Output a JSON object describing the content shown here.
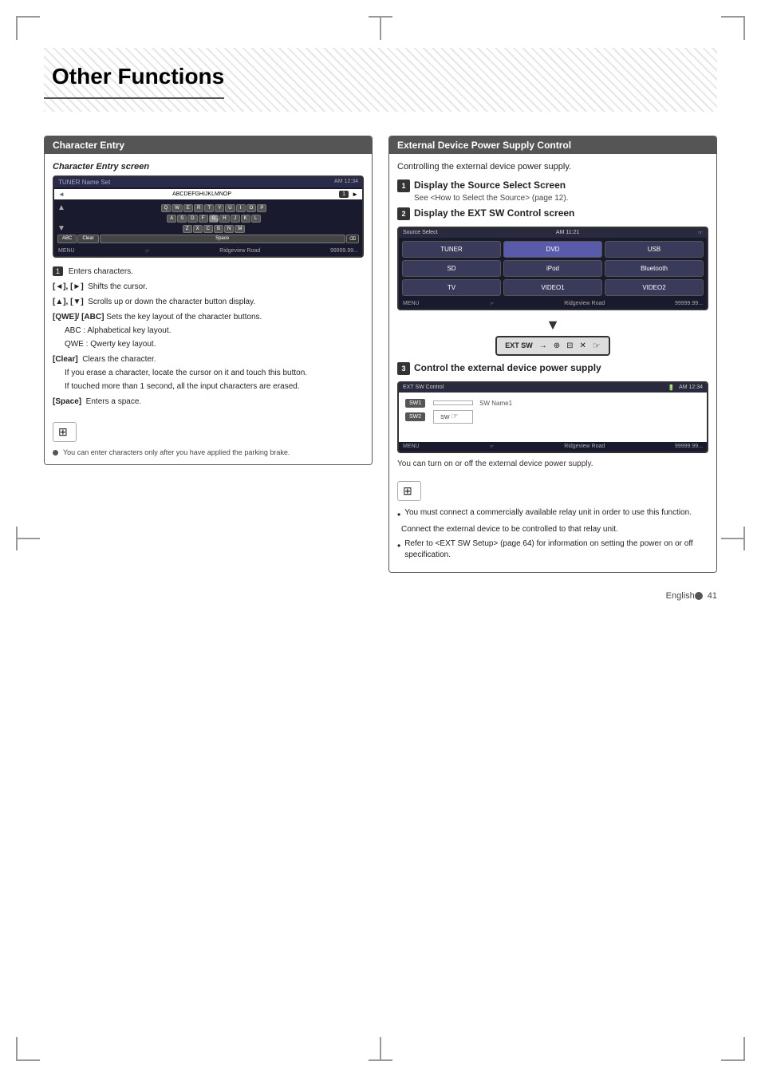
{
  "page": {
    "title": "Other Functions",
    "footer_text": "English",
    "page_number": "41"
  },
  "left_section": {
    "title": "Character Entry",
    "subtitle": "Character Entry screen",
    "screen": {
      "title_bar": "TUNER Name Set",
      "top_bar_icons": "AM 12:34",
      "input_row": "ABCDEFGHIJKLMNOP",
      "input_number": "1",
      "rows": [
        [
          "Q",
          "W",
          "E",
          "R",
          "T",
          "Y",
          "U",
          "I",
          "O",
          "P"
        ],
        [
          "A",
          "S",
          "D",
          "F",
          "G",
          "H",
          "J",
          "K",
          "L"
        ],
        [
          "Z",
          "X",
          "C",
          "B",
          "N",
          "M"
        ]
      ],
      "special_keys": [
        "ABC",
        "Clear",
        "Space"
      ],
      "bottom_left": "MENU",
      "bottom_road": "Ridgeview Road",
      "bottom_right": "99999.99..."
    },
    "items": [
      {
        "number": "1",
        "text": "Enters characters."
      },
      {
        "label": "[◄], [►]",
        "text": "Shifts the cursor."
      },
      {
        "label": "[▲], [▼]",
        "text": "Scrolls up or down the character button display."
      },
      {
        "label": "[QWE]/ [ABC]",
        "text": "Sets the key layout of the character buttons."
      },
      {
        "sublabel1": "ABC : Alphabetical key layout.",
        "sublabel2": "QWE : Qwerty key layout."
      },
      {
        "label": "[Clear]",
        "text": "Clears the character."
      },
      {
        "sub": "If you erase a character, locate the cursor on it and touch this button."
      },
      {
        "sub": "If touched more than 1 second, all the input characters are erased."
      },
      {
        "label": "[Space]",
        "text": "Enters a space."
      }
    ],
    "note_icon": "⊞",
    "note_text": "• You can enter characters only after you have applied the parking brake."
  },
  "right_section": {
    "title": "External Device Power Supply Control",
    "intro": "Controlling the external device power supply.",
    "steps": [
      {
        "number": "1",
        "title": "Display the Source Select Screen",
        "desc": "See <How to Select the Source> (page 12)."
      },
      {
        "number": "2",
        "title": "Display the EXT SW Control screen",
        "source_screen": {
          "top_bar": "Source Select",
          "top_bar_right": "AM 11:21",
          "buttons": [
            "TUNER",
            "DVD",
            "USB",
            "SD",
            "iPod",
            "Bluetooth",
            "TV",
            "VIDEO1",
            "VIDEO2"
          ],
          "bottom_left": "MENU",
          "bottom_road": "Ridgeview Road",
          "bottom_right": "99999.99..."
        },
        "ext_sw_bar": {
          "label": "EXT SW",
          "icons": [
            "→",
            "⊕",
            "⊟",
            "✕"
          ]
        }
      },
      {
        "number": "3",
        "title": "Control the external device power supply",
        "ctrl_screen": {
          "top_bar_left": "EXT SW Control",
          "top_bar_right": "AM 12:34",
          "sw1_label": "SW1",
          "sw1_value": "",
          "sw_name_label": "SW Name1",
          "sw2_label": "SW2",
          "sw2_value": "SW(hand icon)",
          "bottom_left": "MENU",
          "bottom_road": "Ridgeview Road",
          "bottom_right": "99999.99..."
        },
        "desc": "You can turn on or off the external device power supply."
      }
    ],
    "note_icon": "⊞",
    "notes": [
      "You must connect a commercially available relay unit in order to use this function.",
      "Connect the external device to be controlled to that relay unit.",
      "Refer to <EXT SW Setup> (page 64) for information on setting the power on or off specification."
    ]
  }
}
